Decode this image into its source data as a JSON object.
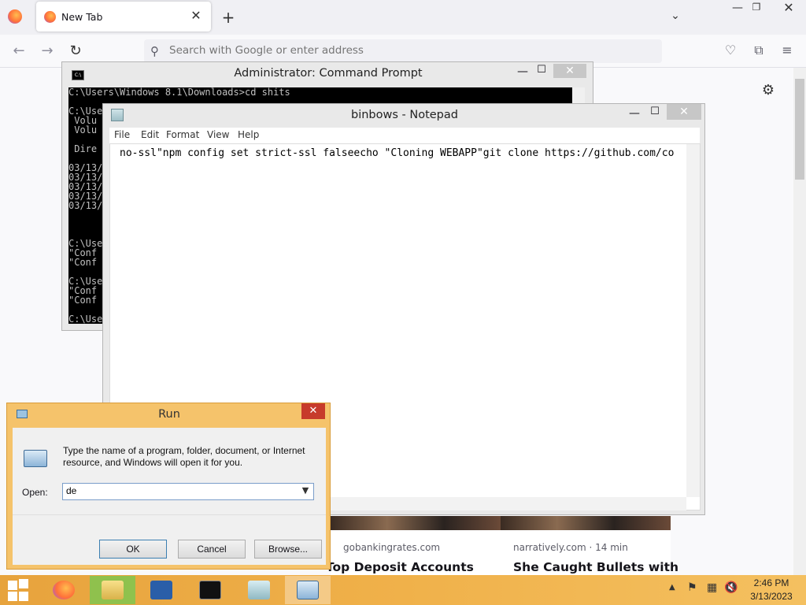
{
  "browser": {
    "tab_title": "New Tab",
    "tab_close": "✕",
    "new_tab": "+",
    "urlbar_placeholder": "Search with Google or enter address",
    "cards": [
      {
        "source": "gobankingrates.com",
        "title": "Top Deposit Accounts"
      },
      {
        "source": "narratively.com · 14 min",
        "title": "She Caught Bullets with"
      }
    ]
  },
  "cmd": {
    "title": "Administrator: Command Prompt",
    "icon_text": "C:\\",
    "lines": [
      "C:\\Users\\Windows 8.1\\Downloads>cd shits",
      "",
      "C:\\Use",
      " Volu",
      " Volu",
      "",
      " Dire",
      "",
      "03/13/",
      "03/13/",
      "03/13/",
      "03/13/",
      "03/13/",
      "",
      "",
      "",
      "C:\\Use",
      "\"Conf",
      "\"Conf",
      "",
      "C:\\Use",
      "\"Conf",
      "\"Conf",
      "",
      "C:\\Use"
    ]
  },
  "notepad": {
    "title": "binbows - Notepad",
    "menu": [
      "File",
      "Edit",
      "Format",
      "View",
      "Help"
    ],
    "text": "no-ssl\"npm config set strict-ssl falseecho \"Cloning WEBAPP\"git clone https://github.com/co"
  },
  "run": {
    "title": "Run",
    "description": "Type the name of a program, folder, document, or Internet resource, and Windows will open it for you.",
    "open_label": "Open:",
    "input_value": "de",
    "ok": "OK",
    "cancel": "Cancel",
    "browse": "Browse..."
  },
  "taskbar": {
    "time": "2:46 PM",
    "date": "3/13/2023"
  }
}
